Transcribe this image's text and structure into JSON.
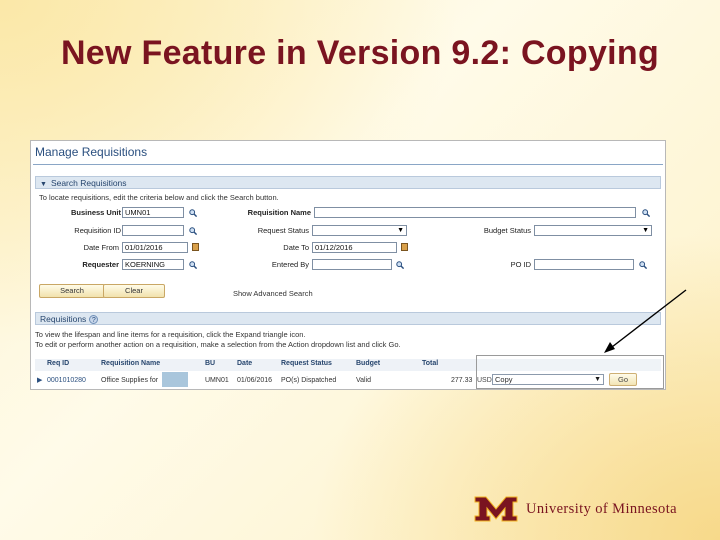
{
  "slide": {
    "title": "New Feature in Version 9.2: Copying"
  },
  "screen": {
    "page_title": "Manage Requisitions",
    "search_section": {
      "header": "Search Requisitions",
      "instructions": "To locate requisitions, edit the criteria below and click the Search button.",
      "fields": {
        "business_unit": {
          "label": "Business Unit",
          "value": "UMN01"
        },
        "requisition_name": {
          "label": "Requisition Name",
          "value": ""
        },
        "requisition_id": {
          "label": "Requisition ID",
          "value": ""
        },
        "request_status": {
          "label": "Request Status",
          "value": ""
        },
        "budget_status": {
          "label": "Budget Status",
          "value": ""
        },
        "date_from": {
          "label": "Date From",
          "value": "01/01/2016"
        },
        "date_to": {
          "label": "Date To",
          "value": "01/12/2016"
        },
        "requester": {
          "label": "Requester",
          "value": "KOERNING"
        },
        "entered_by": {
          "label": "Entered By",
          "value": ""
        },
        "po_id": {
          "label": "PO ID",
          "value": ""
        }
      },
      "search_button": "Search",
      "clear_button": "Clear",
      "advanced_link": "Show Advanced Search"
    },
    "requisitions_section": {
      "header": "Requisitions",
      "instruction_1": "To view the lifespan and line items for a requisition, click the Expand triangle icon.",
      "instruction_2": "To edit or perform another action on a requisition, make a selection from the Action dropdown list and click Go.",
      "columns": [
        "Req ID",
        "Requisition Name",
        "BU",
        "Date",
        "Request Status",
        "Budget",
        "Total"
      ],
      "row": {
        "req_id": "0001010280",
        "name": "Office Supplies for",
        "bu": "UMN01",
        "date": "01/06/2016",
        "status": "PO(s) Dispatched",
        "budget": "Valid",
        "total": "277.33",
        "currency": "USD",
        "action": "Copy",
        "go_button": "Go"
      }
    }
  },
  "footer": {
    "logo_initial": "M",
    "logo_text_1": "University of",
    "logo_text_2": "Minnesota"
  },
  "colors": {
    "title": "#7a1420",
    "maroon": "#7a1420",
    "gold": "#f2b321"
  }
}
